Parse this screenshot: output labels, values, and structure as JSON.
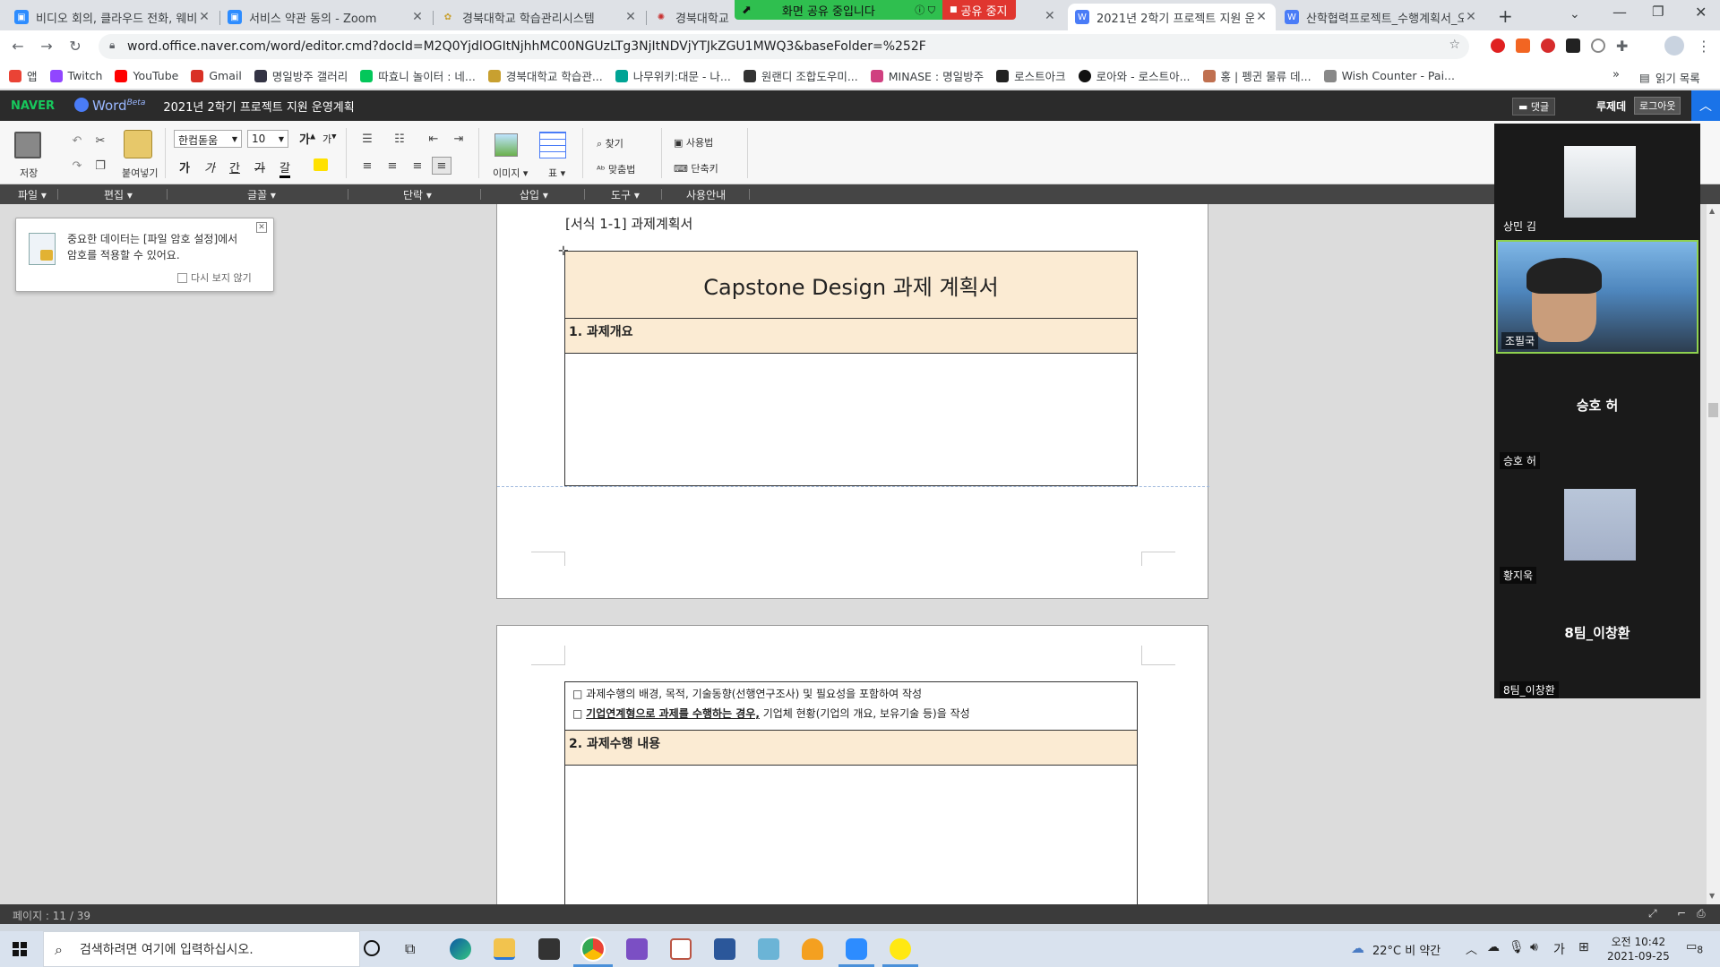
{
  "browser": {
    "tabs": [
      {
        "title": "비디오 회의, 클라우드 전화, 웨비",
        "icon": "zoom-icon",
        "color": "#2d8cff",
        "active": false
      },
      {
        "title": "서비스 약관 동의 - Zoom",
        "icon": "zoom-icon",
        "color": "#2d8cff",
        "active": false
      },
      {
        "title": "경북대학교 학습관리시스템",
        "icon": "knu-icon",
        "color": "#c8a030",
        "active": false
      },
      {
        "title": "경북대학교 I",
        "icon": "knu-seal-icon",
        "color": "#c83030",
        "active": false
      },
      {
        "title": "2021년 2학기 프로젝트 지원 운",
        "icon": "naver-word-icon",
        "color": "#4a7cf7",
        "active": true
      },
      {
        "title": "산학협력프로젝트_수행계획서_오",
        "icon": "naver-word-icon",
        "color": "#4a7cf7",
        "active": false
      }
    ],
    "share_banner": {
      "sharing_label": "화면 공유 중입니다",
      "stop_label": "공유 중지"
    },
    "url": "word.office.naver.com/word/editor.cmd?docId=M2Q0YjdlOGItNjhhMC00NGUzLTg3NjItNDVjYTJkZGU1MWQ3&baseFolder=%252F",
    "bookmarks": [
      {
        "label": "앱",
        "color": "#ea4335"
      },
      {
        "label": "Twitch",
        "color": "#9146ff"
      },
      {
        "label": "YouTube",
        "color": "#ff0000"
      },
      {
        "label": "Gmail",
        "color": "#d93025"
      },
      {
        "label": "명일방주 갤러리",
        "color": "#334"
      },
      {
        "label": "따효니 놀이터 : 네...",
        "color": "#03c75a"
      },
      {
        "label": "경북대학교 학습관...",
        "color": "#c8a030"
      },
      {
        "label": "나무위키:대문 - 나...",
        "color": "#00a495"
      },
      {
        "label": "원랜디 조합도우미...",
        "color": "#333"
      },
      {
        "label": "MINASE : 명일방주",
        "color": "#d04080"
      },
      {
        "label": "로스트아크",
        "color": "#222"
      },
      {
        "label": "로아와 - 로스트아...",
        "color": "#111"
      },
      {
        "label": "홍 | 펭귄 물류 데...",
        "color": "#c07050"
      },
      {
        "label": "Wish Counter - Pai...",
        "color": "#888"
      }
    ],
    "reading_list": "읽기 목록"
  },
  "app": {
    "brand": "NAVER",
    "product": "Word",
    "beta": "Beta",
    "doc_title": "2021년 2학기 프로젝트 지원 운영계획",
    "comment_button": "댓글",
    "user_name": "루제데",
    "logout_button": "로그아웃"
  },
  "ribbon": {
    "save": "저장",
    "paste": "붙여넣기",
    "font_name": "한컴돋움",
    "font_size": "10",
    "image": "이미지",
    "table": "표",
    "find": "찾기",
    "spellcheck": "맞춤법",
    "help": "사용법",
    "shortcut": "단축키",
    "format_buttons": [
      "가",
      "가",
      "간",
      "가",
      "갈"
    ],
    "size_buttons": [
      "가",
      "가"
    ],
    "groups": [
      "파일",
      "편집",
      "글꼴",
      "단락",
      "삽입",
      "도구",
      "사용안내"
    ]
  },
  "popup": {
    "message_line1": "중요한 데이터는 [파일 암호 설정]에서",
    "message_line2": "암호를 적용할 수 있어요.",
    "dont_show": "다시 보지 않기"
  },
  "document": {
    "form_label": "[서식 1-1] 과제계획서",
    "main_title": "Capstone Design 과제 계획서",
    "section1": "1. 과제개요",
    "bullet1": "□ 과제수행의 배경, 목적, 기술동향(선행연구조사) 및 필요성을 포함하여 작성",
    "bullet2_prefix": "□ ",
    "bullet2_underlined": "기업연계형으로 과제를 수행하는 경우,",
    "bullet2_suffix": " 기업체 현황(기업의 개요, 보유기술 등)을 작성",
    "section2": "2. 과제수행 내용"
  },
  "status": {
    "page_info": "페이지 : 11 / 39"
  },
  "video": {
    "participants": [
      {
        "name": "상민 김",
        "display": ""
      },
      {
        "name": "조필국",
        "display": ""
      },
      {
        "name": "승호 허",
        "display": "승호 허"
      },
      {
        "name": "황지욱",
        "display": ""
      },
      {
        "name": "8팀_이창환",
        "display": "8팀_이창환"
      }
    ]
  },
  "taskbar": {
    "search_placeholder": "검색하려면 여기에 입력하십시오.",
    "weather": "22°C  비 약간",
    "ime": "가",
    "time": "오전 10:42",
    "date": "2021-09-25",
    "notifications": "8"
  }
}
